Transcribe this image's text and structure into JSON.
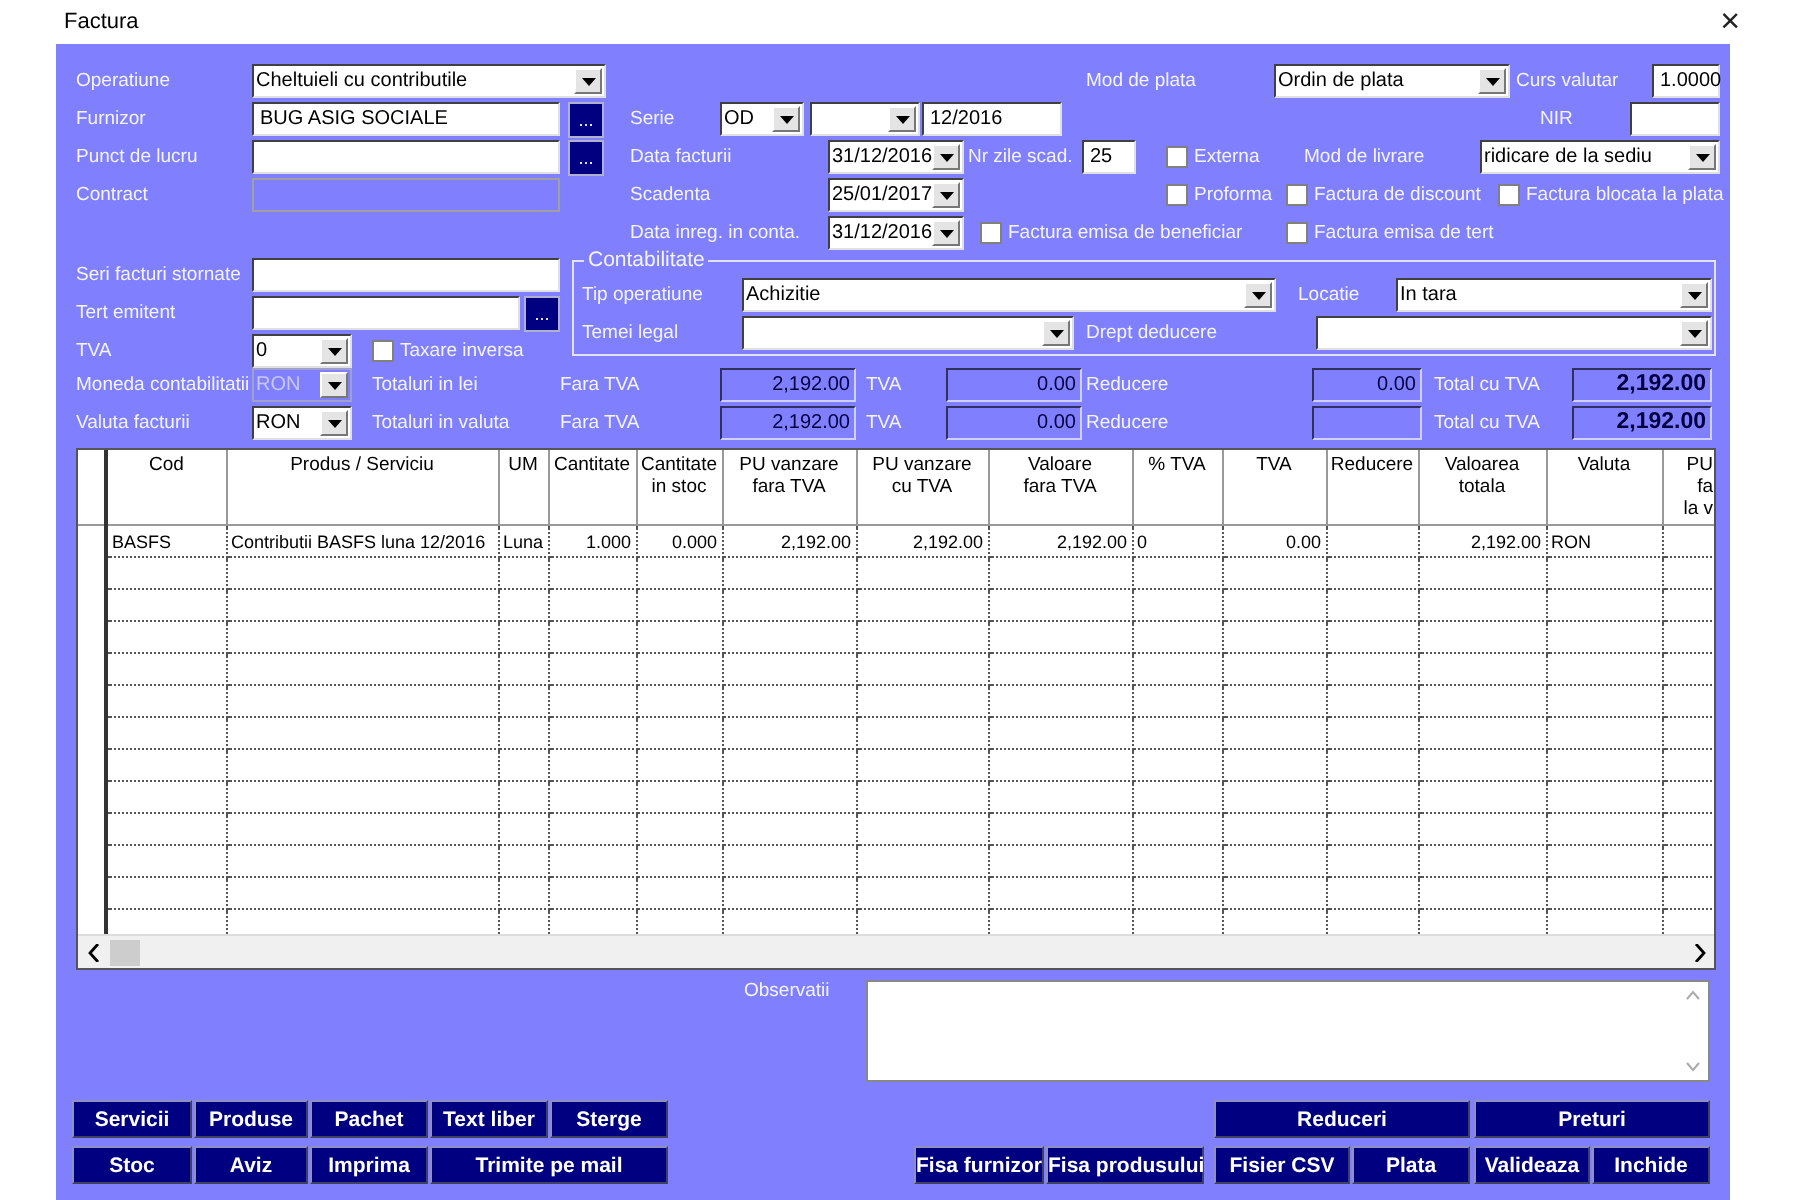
{
  "window": {
    "title": "Factura",
    "close": "×"
  },
  "top_rows": [
    [
      {
        "kind": "label",
        "text": "Operatiune"
      },
      {
        "kind": "combo",
        "value": "Cheltuieli cu contributile"
      },
      {
        "kind": "label",
        "text": "Mod de plata"
      },
      {
        "kind": "combo",
        "value": "Ordin de plata"
      },
      {
        "kind": "label",
        "text": "Curs valutar"
      },
      {
        "kind": "input",
        "value": "1.0000"
      }
    ],
    [
      {
        "kind": "label",
        "text": "Furnizor"
      },
      {
        "kind": "input",
        "value": "BUG ASIG SOCIALE"
      },
      {
        "kind": "browse",
        "text": "..."
      },
      {
        "kind": "label",
        "text": "Serie"
      },
      {
        "kind": "combo",
        "value": "OD"
      },
      {
        "kind": "combo"
      },
      {
        "kind": "input",
        "value": "12/2016"
      },
      {
        "kind": "label",
        "text": "NIR"
      },
      {
        "kind": "input"
      }
    ],
    [
      {
        "kind": "label",
        "text": "Punct de lucru"
      },
      {
        "kind": "input"
      },
      {
        "kind": "browse",
        "text": "..."
      },
      {
        "kind": "label",
        "text": "Data facturii"
      },
      {
        "kind": "date",
        "value": "31/12/2016"
      },
      {
        "kind": "label",
        "text": "Nr zile scad."
      },
      {
        "kind": "input",
        "value": "25"
      },
      {
        "kind": "check",
        "label": "Externa",
        "checked": false
      },
      {
        "kind": "label",
        "text": "Mod de livrare"
      },
      {
        "kind": "combo",
        "value": "ridicare de la sediu"
      }
    ],
    [
      {
        "kind": "label",
        "text": "Contract"
      },
      {
        "kind": "locked-input"
      },
      {
        "kind": "label",
        "text": "Scadenta"
      },
      {
        "kind": "date",
        "value": "25/01/2017"
      },
      {
        "kind": "check",
        "label": "Proforma",
        "checked": false
      },
      {
        "kind": "check",
        "label": "Factura de discount",
        "checked": false
      },
      {
        "kind": "check",
        "label": "Factura blocata la plata",
        "checked": false
      }
    ],
    [
      {
        "kind": "label",
        "text": "Data inreg. in conta."
      },
      {
        "kind": "date",
        "value": "31/12/2016"
      },
      {
        "kind": "check",
        "label": "Factura emisa de beneficiar",
        "checked": false
      },
      {
        "kind": "check",
        "label": "Factura emisa de tert",
        "checked": false
      }
    ]
  ],
  "left_rows": [
    [
      {
        "kind": "label",
        "text": "Seri facturi stornate"
      },
      {
        "kind": "input"
      }
    ],
    [
      {
        "kind": "label",
        "text": "Tert emitent"
      },
      {
        "kind": "input"
      },
      {
        "kind": "browse",
        "text": "..."
      }
    ],
    [
      {
        "kind": "label",
        "text": "TVA"
      },
      {
        "kind": "combo",
        "value": "0"
      },
      {
        "kind": "check",
        "label": "Taxare inversa",
        "checked": false
      }
    ]
  ],
  "contabilitate": {
    "title": "Contabilitate",
    "rows": [
      [
        {
          "kind": "label",
          "text": "Tip operatiune"
        },
        {
          "kind": "combo",
          "value": "Achizitie"
        },
        {
          "kind": "label",
          "text": "Locatie"
        },
        {
          "kind": "combo",
          "value": "In tara"
        }
      ],
      [
        {
          "kind": "label",
          "text": "Temei legal"
        },
        {
          "kind": "combo"
        },
        {
          "kind": "label",
          "text": "Drept deducere"
        },
        {
          "kind": "combo"
        }
      ]
    ]
  },
  "totals_rows": [
    [
      {
        "kind": "label",
        "text": "Moneda contabilitatii"
      },
      {
        "kind": "locked-combo",
        "value": "RON"
      },
      {
        "kind": "label",
        "text": "Totaluri in lei"
      },
      {
        "kind": "label",
        "text": "Fara TVA"
      },
      {
        "kind": "amount",
        "value": "2,192.00"
      },
      {
        "kind": "label",
        "text": "TVA"
      },
      {
        "kind": "amount",
        "value": "0.00"
      },
      {
        "kind": "label",
        "text": "Reducere"
      },
      {
        "kind": "amount",
        "value": "0.00"
      },
      {
        "kind": "label",
        "text": "Total cu TVA"
      },
      {
        "kind": "total",
        "value": "2,192.00"
      }
    ],
    [
      {
        "kind": "label",
        "text": "Valuta facturii"
      },
      {
        "kind": "combo",
        "value": "RON"
      },
      {
        "kind": "label",
        "text": "Totaluri in valuta"
      },
      {
        "kind": "label",
        "text": "Fara TVA"
      },
      {
        "kind": "amount",
        "value": "2,192.00"
      },
      {
        "kind": "label",
        "text": "TVA"
      },
      {
        "kind": "amount",
        "value": "0.00"
      },
      {
        "kind": "label",
        "text": "Reducere"
      },
      {
        "kind": "amount"
      },
      {
        "kind": "label",
        "text": "Total cu TVA"
      },
      {
        "kind": "total",
        "value": "2,192.00"
      }
    ]
  ],
  "table": {
    "columns": [
      "Cod",
      "Produs / Serviciu",
      "UM",
      "Cantitate",
      "Cantitate\nin stoc",
      "PU vanzare\nfara TVA",
      "PU vanzare\ncu TVA",
      "Valoare\nfara TVA",
      "% TVA",
      "TVA",
      "Reducere",
      "Valoarea totala",
      "Valuta",
      "PU\nfa\nla v"
    ],
    "rows": [
      [
        "BASFS",
        "Contributii BASFS luna 12/2016",
        "Luna",
        "1.000",
        "0.000",
        "2,192.00",
        "2,192.00",
        "2,192.00",
        "0",
        "0.00",
        "",
        "2,192.00",
        "RON",
        ""
      ]
    ]
  },
  "observatii": {
    "label": "Observatii"
  },
  "buttons": [
    [
      "Servicii",
      "Produse",
      "Pachet",
      "Text liber",
      "Sterge",
      "Reduceri",
      "Preturi"
    ],
    [
      "Stoc",
      "Aviz",
      "Imprima",
      "Trimite pe mail",
      "Fisa furnizor",
      "Fisa produsului",
      "Fisier CSV",
      "Plata",
      "Valideaza",
      "Inchide"
    ]
  ]
}
